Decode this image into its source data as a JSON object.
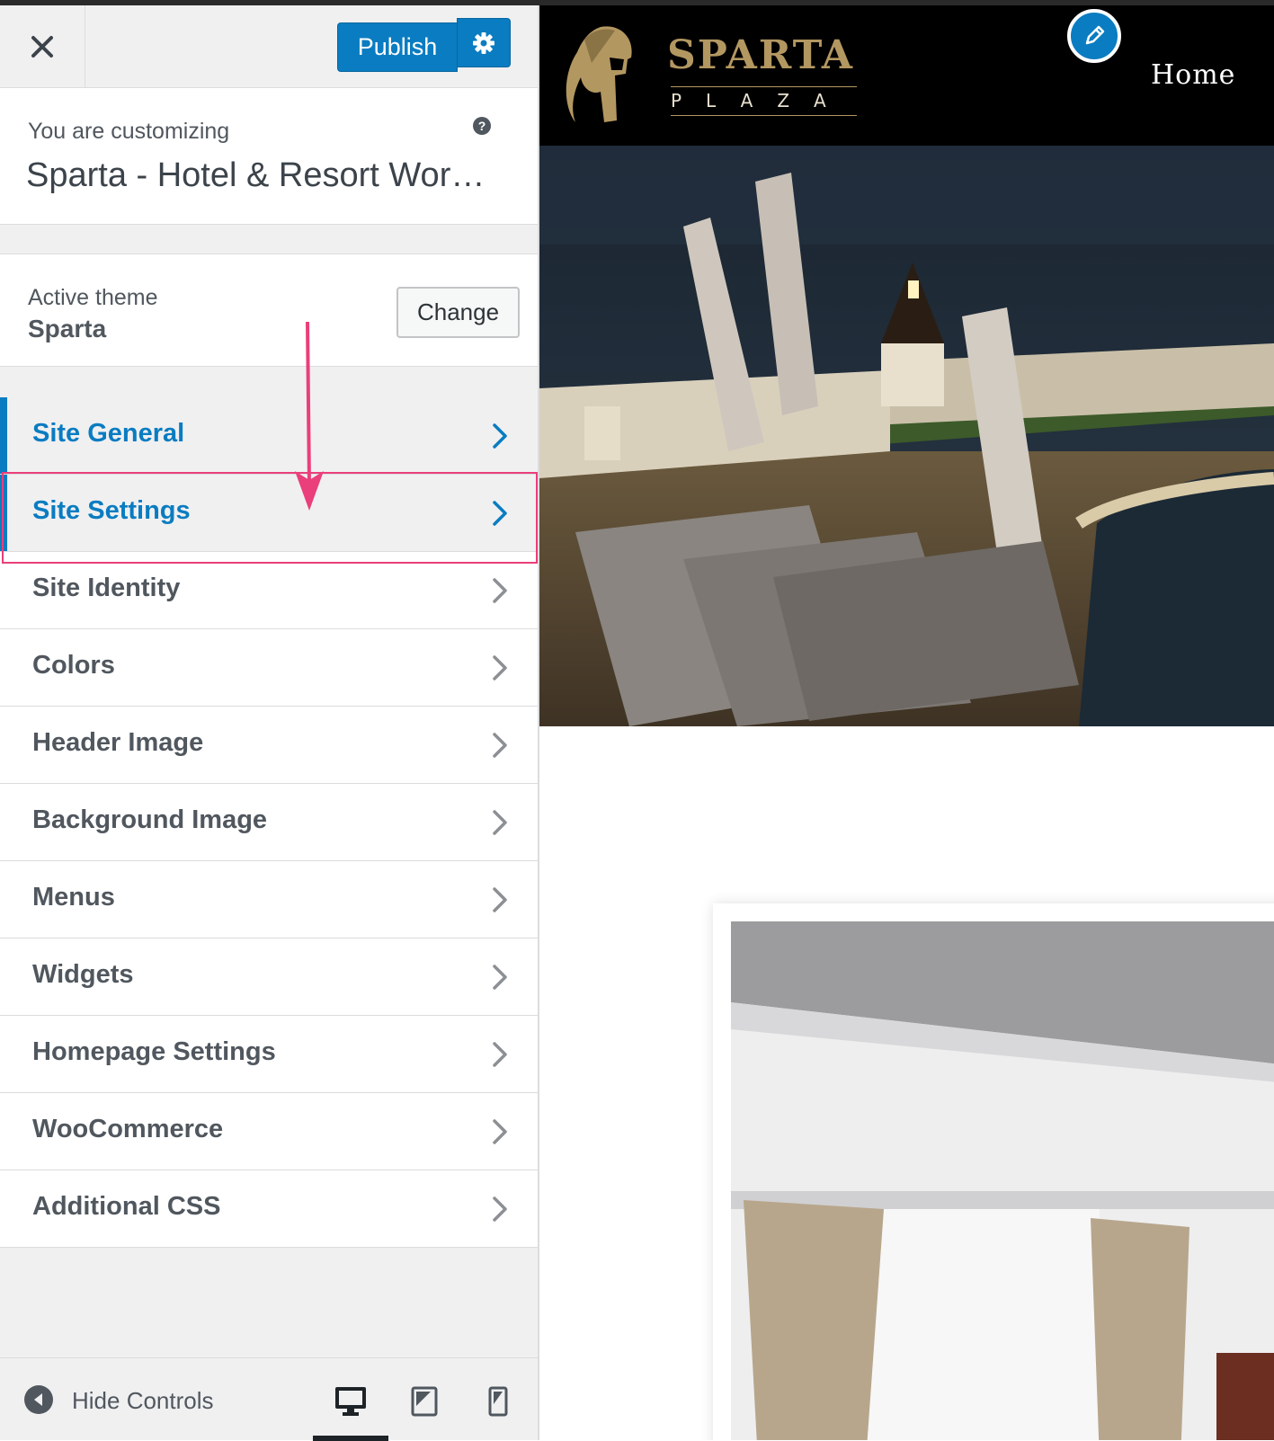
{
  "header": {
    "publish_label": "Publish"
  },
  "customizing": {
    "label": "You are customizing",
    "title": "Sparta - Hotel & Resort WordP..."
  },
  "theme": {
    "label": "Active theme",
    "name": "Sparta",
    "change_label": "Change"
  },
  "panels": [
    {
      "label": "Site General",
      "active": true
    },
    {
      "label": "Site Settings",
      "active": true,
      "highlighted": true
    },
    {
      "label": "Site Identity"
    },
    {
      "label": "Colors"
    },
    {
      "label": "Header Image"
    },
    {
      "label": "Background Image"
    },
    {
      "label": "Menus"
    },
    {
      "label": "Widgets"
    },
    {
      "label": "Homepage Settings"
    },
    {
      "label": "WooCommerce"
    },
    {
      "label": "Additional CSS"
    }
  ],
  "footer": {
    "hide_controls_label": "Hide Controls",
    "devices": [
      "desktop-icon",
      "tablet-icon",
      "mobile-icon"
    ],
    "active_device": "desktop"
  },
  "preview": {
    "logo_title": "SPARTA",
    "logo_subtitle": "PLAZA",
    "nav": [
      "Home"
    ]
  },
  "colors": {
    "accent": "#0a7cc1",
    "annotation": "#ea3f7a",
    "logo_gold": "#b39761"
  }
}
